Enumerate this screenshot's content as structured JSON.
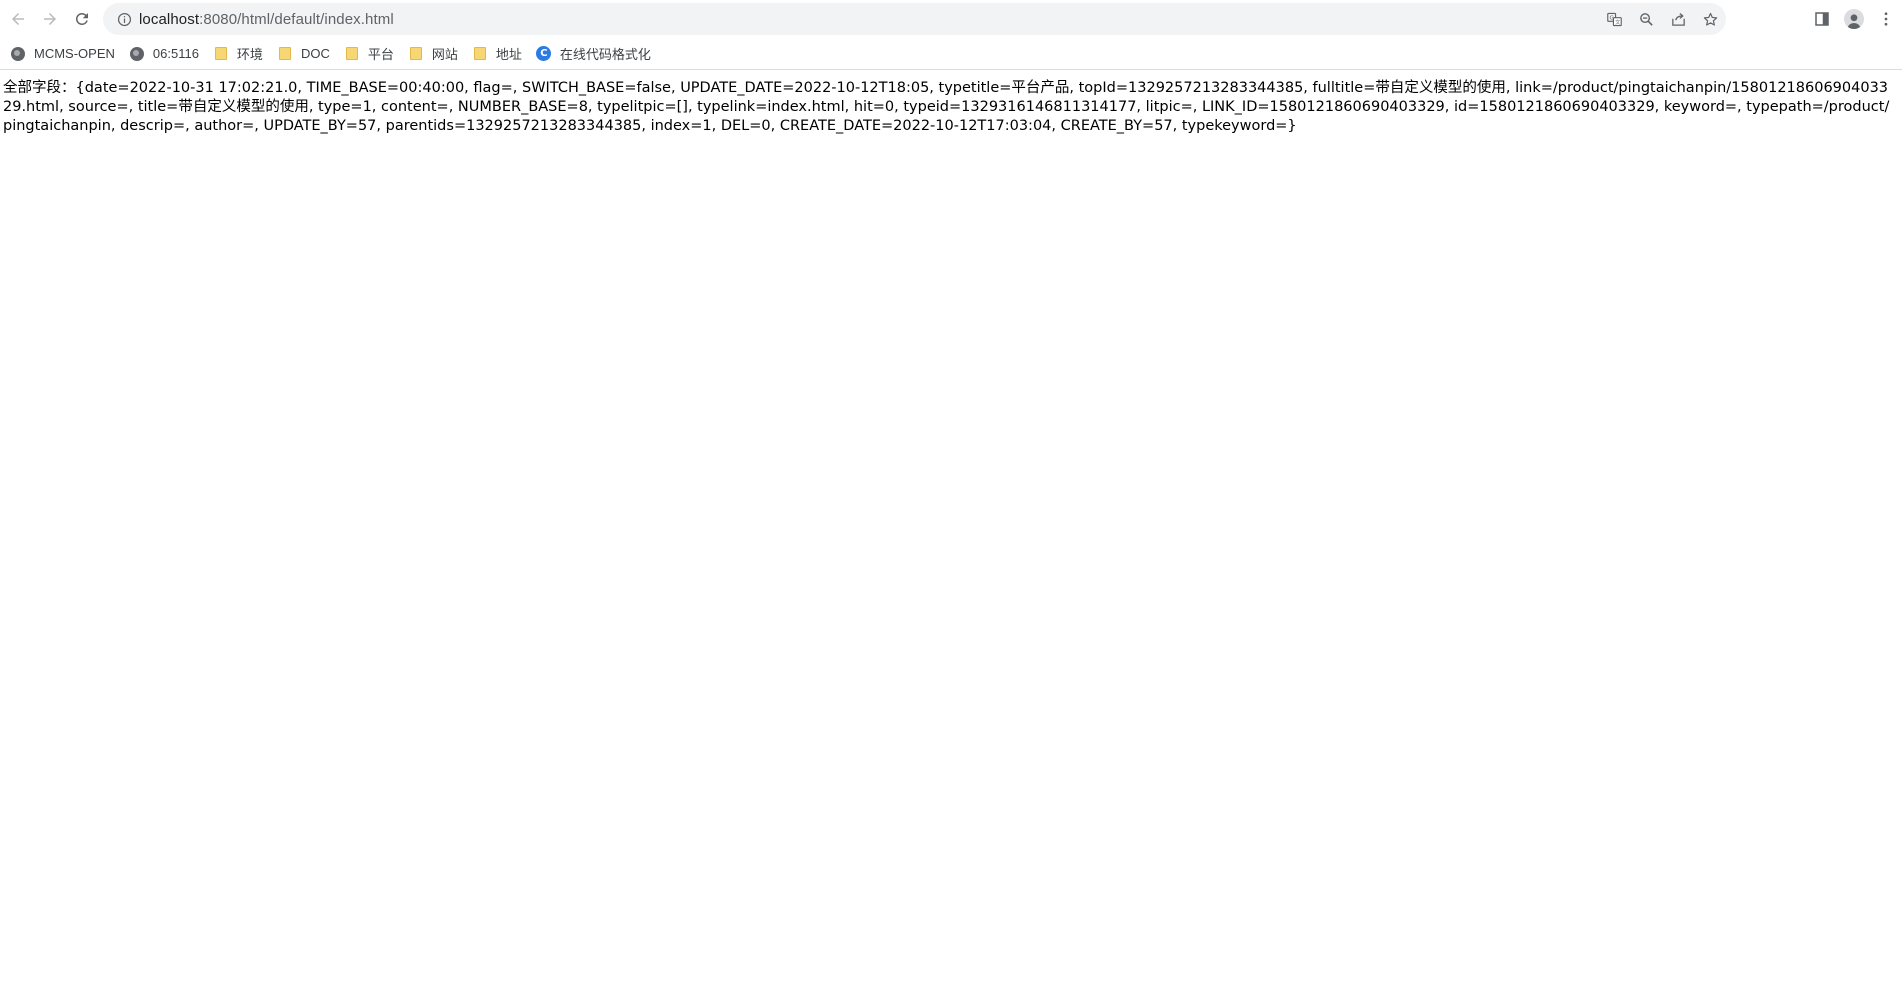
{
  "browser": {
    "url_host": "localhost",
    "url_rest": ":8080/html/default/index.html"
  },
  "bookmarks": [
    {
      "label": "MCMS-OPEN",
      "icon": "globe-icon"
    },
    {
      "label": "06:5116",
      "icon": "globe-icon"
    },
    {
      "label": "环境",
      "icon": "folder-icon"
    },
    {
      "label": "DOC",
      "icon": "folder-icon"
    },
    {
      "label": "平台",
      "icon": "folder-icon"
    },
    {
      "label": "网站",
      "icon": "folder-icon"
    },
    {
      "label": "地址",
      "icon": "folder-icon"
    },
    {
      "label": "在线代码格式化",
      "icon": "code-format-icon"
    }
  ],
  "page": {
    "content": "全部字段：{date=2022-10-31 17:02:21.0, TIME_BASE=00:40:00, flag=, SWITCH_BASE=false, UPDATE_DATE=2022-10-12T18:05, typetitle=平台产品, topId=1329257213283344385, fulltitle=带自定义模型的使用, link=/product/pingtaichanpin/1580121860690403329.html, source=, title=带自定义模型的使用, type=1, content=, NUMBER_BASE=8, typelitpic=[], typelink=index.html, hit=0, typeid=1329316146811314177, litpic=, LINK_ID=1580121860690403329, id=1580121860690403329, keyword=, typepath=/product/pingtaichanpin, descrip=, author=, UPDATE_BY=57, parentids=1329257213283344385, index=1, DEL=0, CREATE_DATE=2022-10-12T17:03:04, CREATE_BY=57, typekeyword=}"
  }
}
